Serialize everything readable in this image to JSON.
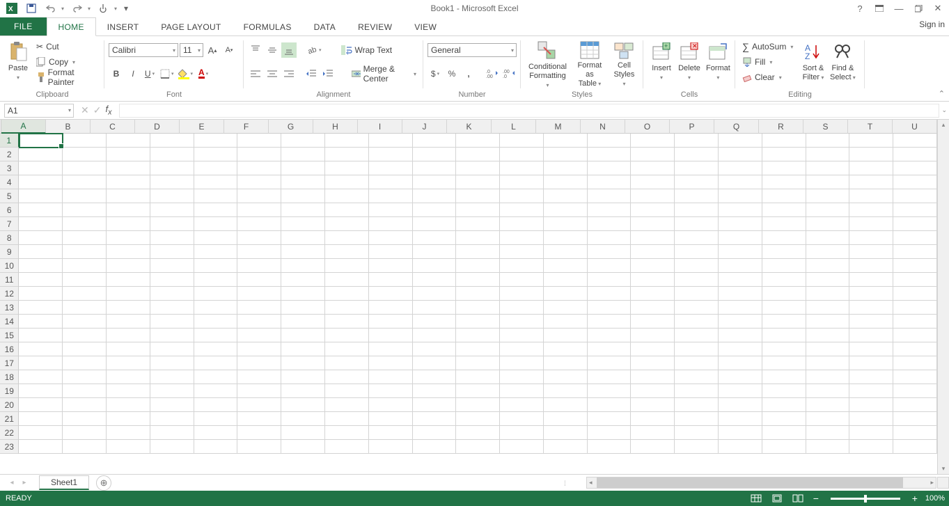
{
  "title": "Book1 - Microsoft Excel",
  "signin": "Sign in",
  "tabs": {
    "file": "FILE",
    "home": "HOME",
    "insert": "INSERT",
    "page_layout": "PAGE LAYOUT",
    "formulas": "FORMULAS",
    "data": "DATA",
    "review": "REVIEW",
    "view": "VIEW",
    "active": "HOME"
  },
  "ribbon": {
    "clipboard": {
      "label": "Clipboard",
      "paste": "Paste",
      "cut": "Cut",
      "copy": "Copy",
      "format_painter": "Format Painter"
    },
    "font": {
      "label": "Font",
      "name": "Calibri",
      "size": "11"
    },
    "alignment": {
      "label": "Alignment",
      "wrap": "Wrap Text",
      "merge": "Merge & Center"
    },
    "number": {
      "label": "Number",
      "format": "General"
    },
    "styles": {
      "label": "Styles",
      "cond": "Conditional\nFormatting",
      "table": "Format as\nTable",
      "cell": "Cell\nStyles"
    },
    "cells": {
      "label": "Cells",
      "insert": "Insert",
      "delete": "Delete",
      "format": "Format"
    },
    "editing": {
      "label": "Editing",
      "autosum": "AutoSum",
      "fill": "Fill",
      "clear": "Clear",
      "sort": "Sort &\nFilter",
      "find": "Find &\nSelect"
    }
  },
  "namebox": "A1",
  "columns": [
    "A",
    "B",
    "C",
    "D",
    "E",
    "F",
    "G",
    "H",
    "I",
    "J",
    "K",
    "L",
    "M",
    "N",
    "O",
    "P",
    "Q",
    "R",
    "S",
    "T",
    "U"
  ],
  "rows": [
    1,
    2,
    3,
    4,
    5,
    6,
    7,
    8,
    9,
    10,
    11,
    12,
    13,
    14,
    15,
    16,
    17,
    18,
    19,
    20,
    21,
    22,
    23
  ],
  "active_cell": {
    "col": "A",
    "row": 1
  },
  "sheet_tab": "Sheet1",
  "status": "READY",
  "zoom": "100%"
}
